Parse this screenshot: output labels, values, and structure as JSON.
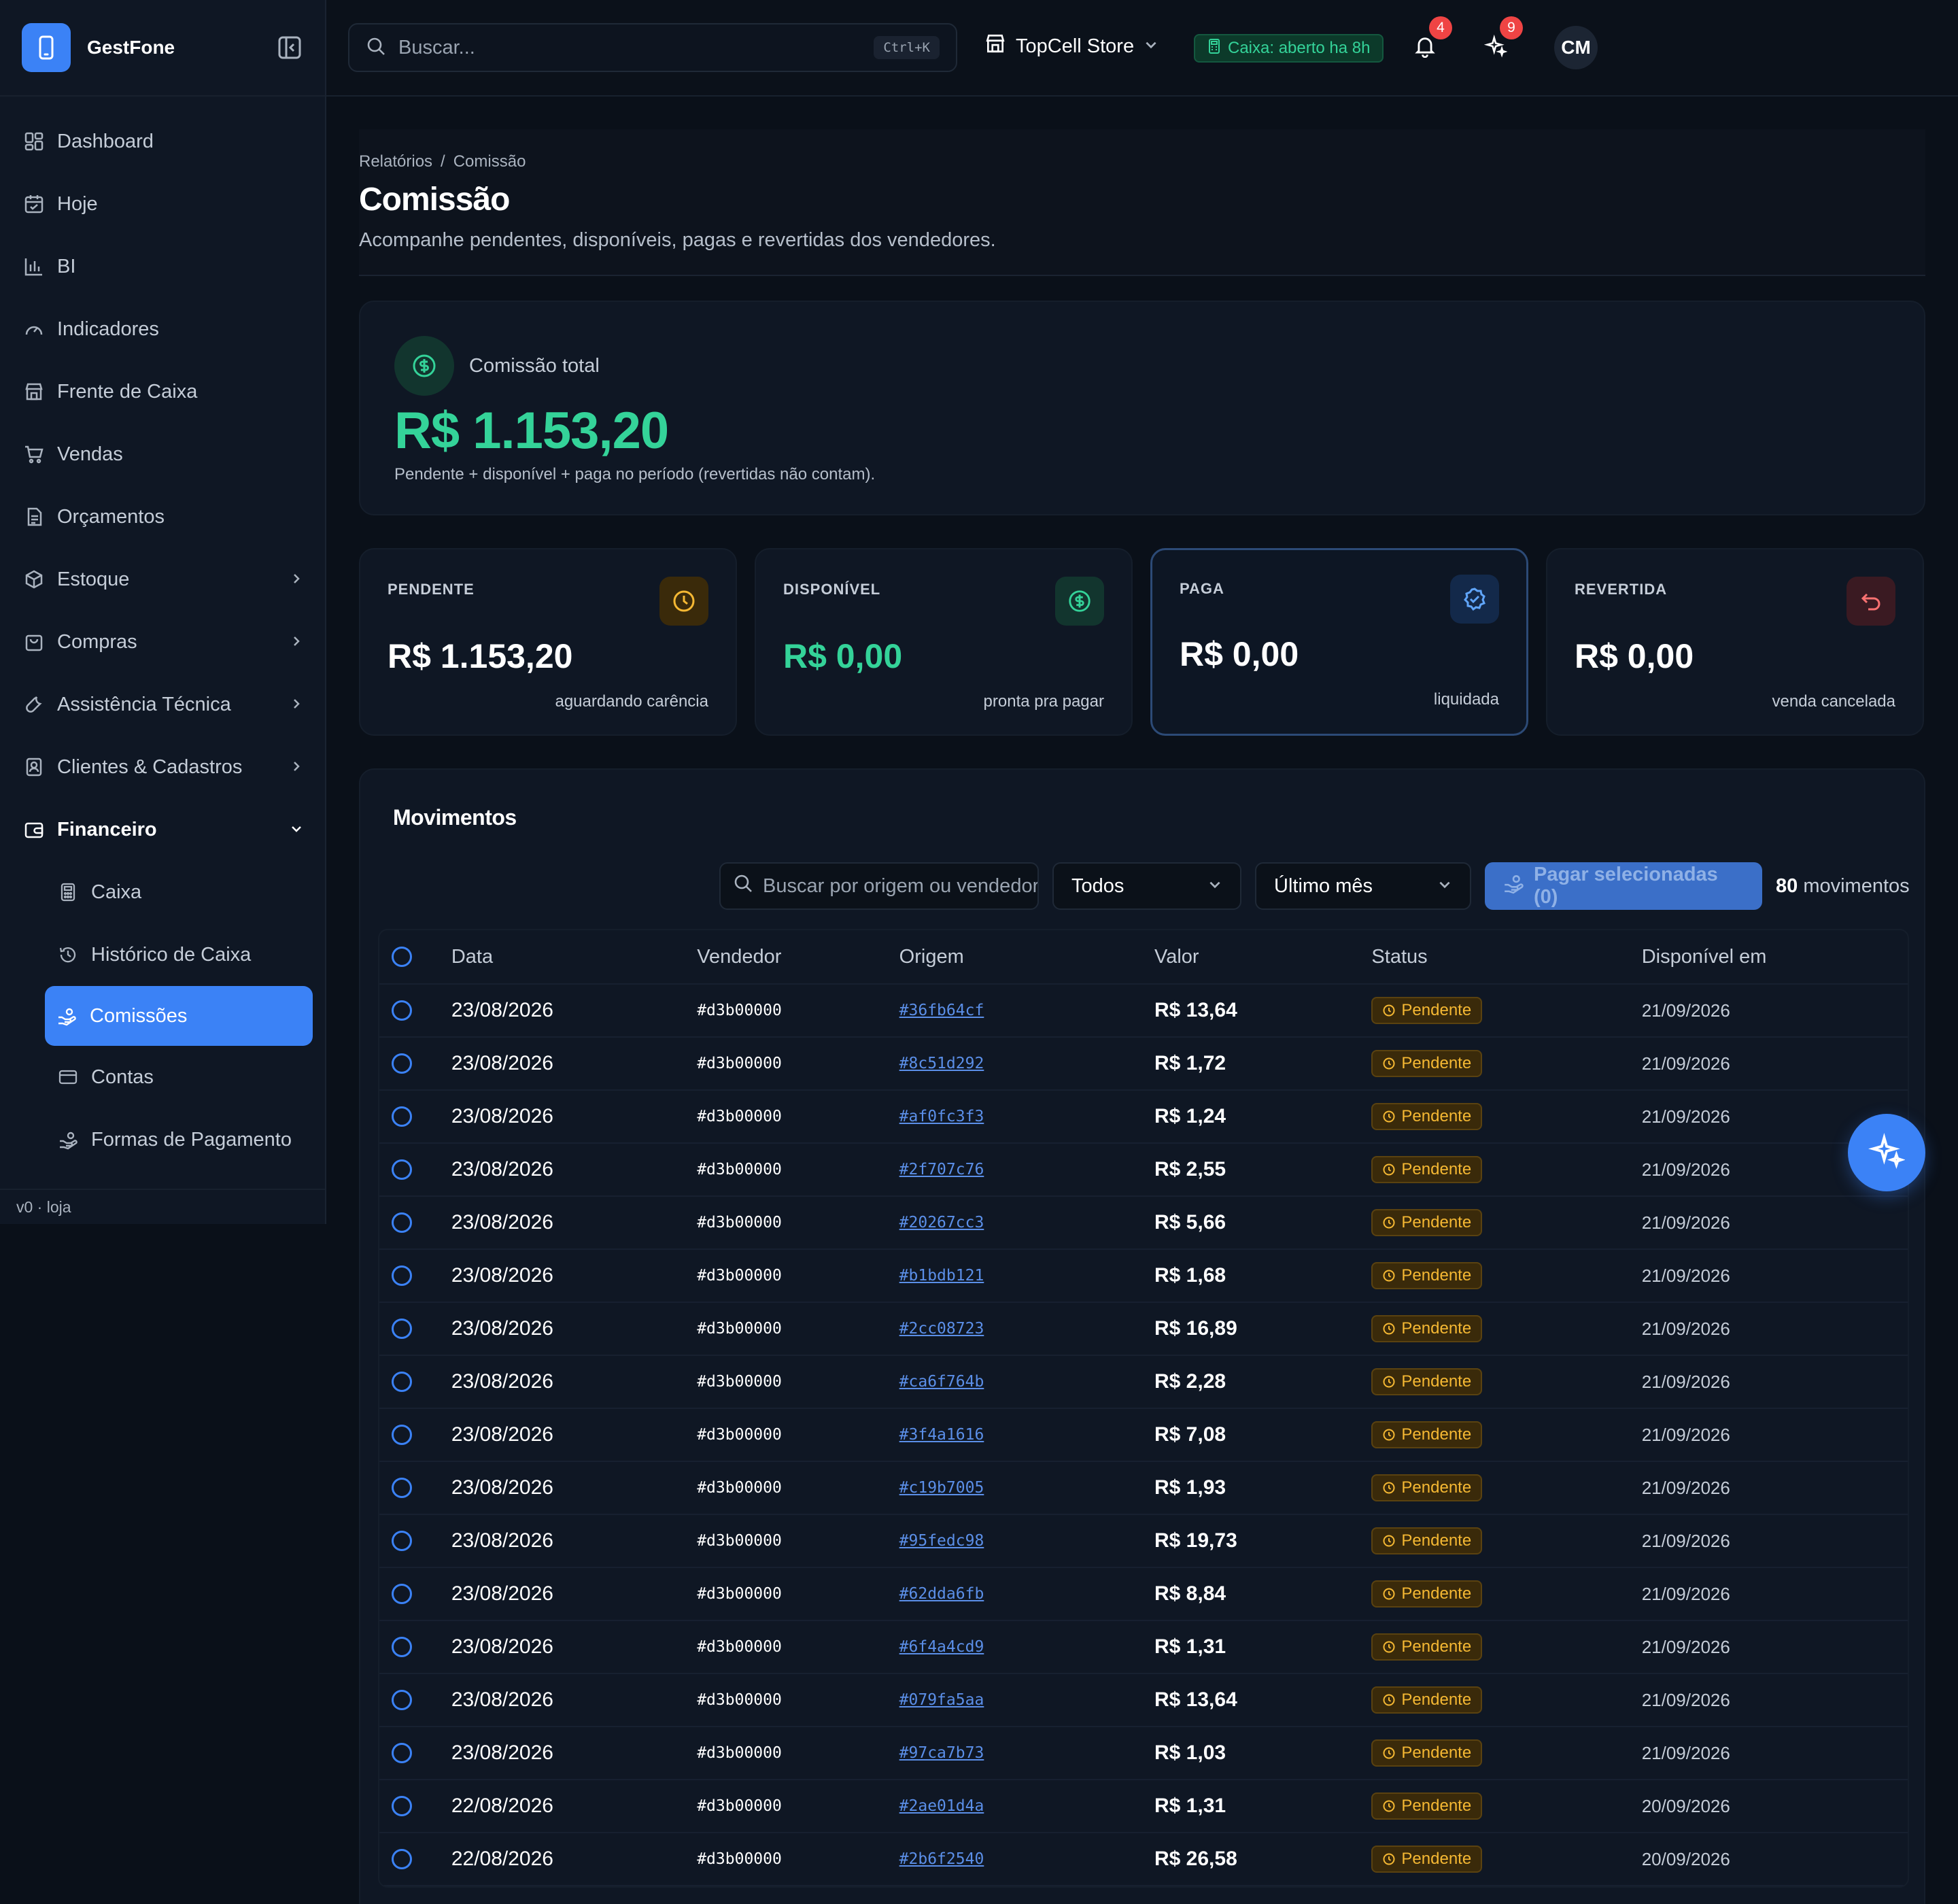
{
  "app": {
    "name": "GestFone",
    "version": "v0 · loja"
  },
  "search": {
    "placeholder": "Buscar...",
    "shortcut": "Ctrl+K"
  },
  "store": {
    "name": "TopCell Store"
  },
  "cash_status": "Caixa: aberto ha 8h",
  "notifications": {
    "count": "4"
  },
  "ai": {
    "count": "9"
  },
  "user": {
    "initials": "CM"
  },
  "sidebar": {
    "items": [
      {
        "label": "Dashboard"
      },
      {
        "label": "Hoje"
      },
      {
        "label": "BI"
      },
      {
        "label": "Indicadores"
      },
      {
        "label": "Frente de Caixa"
      },
      {
        "label": "Vendas"
      },
      {
        "label": "Orçamentos"
      },
      {
        "label": "Estoque"
      },
      {
        "label": "Compras"
      },
      {
        "label": "Assistência Técnica"
      },
      {
        "label": "Clientes & Cadastros"
      },
      {
        "label": "Financeiro"
      }
    ],
    "sub_items": [
      {
        "label": "Caixa"
      },
      {
        "label": "Histórico de Caixa"
      },
      {
        "label": "Comissões"
      },
      {
        "label": "Contas"
      },
      {
        "label": "Formas de Pagamento"
      }
    ]
  },
  "breadcrumb": {
    "parent": "Relatórios",
    "sep": "/",
    "current": "Comissão"
  },
  "page": {
    "title": "Comissão",
    "subtitle": "Acompanhe pendentes, disponíveis, pagas e revertidas dos vendedores."
  },
  "total": {
    "label": "Comissão total",
    "value": "R$ 1.153,20",
    "note": "Pendente + disponível + paga no período (revertidas não contam)."
  },
  "kpis": [
    {
      "label": "PENDENTE",
      "value": "R$ 1.153,20",
      "note": "aguardando carência"
    },
    {
      "label": "DISPONÍVEL",
      "value": "R$ 0,00",
      "note": "pronta pra pagar"
    },
    {
      "label": "PAGA",
      "value": "R$ 0,00",
      "note": "liquidada"
    },
    {
      "label": "REVERTIDA",
      "value": "R$ 0,00",
      "note": "venda cancelada"
    }
  ],
  "movements": {
    "title": "Movimentos",
    "search_placeholder": "Buscar por origem ou vendedor",
    "status_filter": "Todos",
    "period_filter": "Último mês",
    "pay_button": "Pagar selecionadas (0)",
    "count": "80",
    "count_label": "movimentos",
    "columns": [
      "Data",
      "Vendedor",
      "Origem",
      "Valor",
      "Status",
      "Disponível em"
    ],
    "rows": [
      {
        "date": "23/08/2026",
        "seller": "#d3b00000",
        "origin": "#36fb64cf",
        "value": "R$ 13,64",
        "status": "Pendente",
        "available": "21/09/2026"
      },
      {
        "date": "23/08/2026",
        "seller": "#d3b00000",
        "origin": "#8c51d292",
        "value": "R$ 1,72",
        "status": "Pendente",
        "available": "21/09/2026"
      },
      {
        "date": "23/08/2026",
        "seller": "#d3b00000",
        "origin": "#af0fc3f3",
        "value": "R$ 1,24",
        "status": "Pendente",
        "available": "21/09/2026"
      },
      {
        "date": "23/08/2026",
        "seller": "#d3b00000",
        "origin": "#2f707c76",
        "value": "R$ 2,55",
        "status": "Pendente",
        "available": "21/09/2026"
      },
      {
        "date": "23/08/2026",
        "seller": "#d3b00000",
        "origin": "#20267cc3",
        "value": "R$ 5,66",
        "status": "Pendente",
        "available": "21/09/2026"
      },
      {
        "date": "23/08/2026",
        "seller": "#d3b00000",
        "origin": "#b1bdb121",
        "value": "R$ 1,68",
        "status": "Pendente",
        "available": "21/09/2026"
      },
      {
        "date": "23/08/2026",
        "seller": "#d3b00000",
        "origin": "#2cc08723",
        "value": "R$ 16,89",
        "status": "Pendente",
        "available": "21/09/2026"
      },
      {
        "date": "23/08/2026",
        "seller": "#d3b00000",
        "origin": "#ca6f764b",
        "value": "R$ 2,28",
        "status": "Pendente",
        "available": "21/09/2026"
      },
      {
        "date": "23/08/2026",
        "seller": "#d3b00000",
        "origin": "#3f4a1616",
        "value": "R$ 7,08",
        "status": "Pendente",
        "available": "21/09/2026"
      },
      {
        "date": "23/08/2026",
        "seller": "#d3b00000",
        "origin": "#c19b7005",
        "value": "R$ 1,93",
        "status": "Pendente",
        "available": "21/09/2026"
      },
      {
        "date": "23/08/2026",
        "seller": "#d3b00000",
        "origin": "#95fedc98",
        "value": "R$ 19,73",
        "status": "Pendente",
        "available": "21/09/2026"
      },
      {
        "date": "23/08/2026",
        "seller": "#d3b00000",
        "origin": "#62dda6fb",
        "value": "R$ 8,84",
        "status": "Pendente",
        "available": "21/09/2026"
      },
      {
        "date": "23/08/2026",
        "seller": "#d3b00000",
        "origin": "#6f4a4cd9",
        "value": "R$ 1,31",
        "status": "Pendente",
        "available": "21/09/2026"
      },
      {
        "date": "23/08/2026",
        "seller": "#d3b00000",
        "origin": "#079fa5aa",
        "value": "R$ 13,64",
        "status": "Pendente",
        "available": "21/09/2026"
      },
      {
        "date": "23/08/2026",
        "seller": "#d3b00000",
        "origin": "#97ca7b73",
        "value": "R$ 1,03",
        "status": "Pendente",
        "available": "21/09/2026"
      },
      {
        "date": "22/08/2026",
        "seller": "#d3b00000",
        "origin": "#2ae01d4a",
        "value": "R$ 1,31",
        "status": "Pendente",
        "available": "20/09/2026"
      },
      {
        "date": "22/08/2026",
        "seller": "#d3b00000",
        "origin": "#2b6f2540",
        "value": "R$ 26,58",
        "status": "Pendente",
        "available": "20/09/2026"
      }
    ]
  },
  "colors": {
    "accent": "#3b82f6",
    "success": "#34d399",
    "warning": "#f5b833",
    "danger": "#ef4444"
  }
}
